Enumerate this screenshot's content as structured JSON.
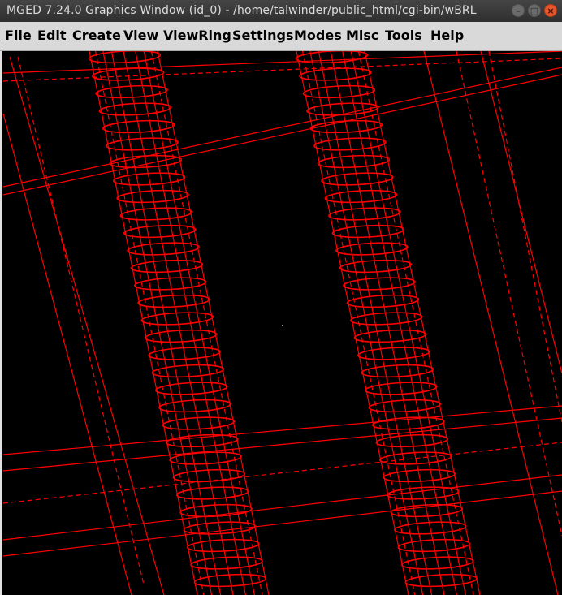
{
  "window": {
    "title": "MGED 7.24.0 Graphics Window (id_0) - /home/talwinder/public_html/cgi-bin/wBRL",
    "buttons": [
      "minimize",
      "maximize",
      "close"
    ]
  },
  "menubar": {
    "items": [
      {
        "label": "File",
        "accel": "F"
      },
      {
        "label": "Edit",
        "accel": "E"
      },
      {
        "label": "Create",
        "accel": "C"
      },
      {
        "label": "View",
        "accel": "V"
      },
      {
        "label": "ViewRing",
        "accel": "R"
      },
      {
        "label": "Settings",
        "accel": "S"
      },
      {
        "label": "Modes",
        "accel": "M"
      },
      {
        "label": "Misc",
        "accel": "i"
      },
      {
        "label": "Tools",
        "accel": "T"
      },
      {
        "label": "Help",
        "accel": "H"
      }
    ]
  },
  "viewport": {
    "background": "#000000",
    "wire_color": "#ff0000"
  }
}
